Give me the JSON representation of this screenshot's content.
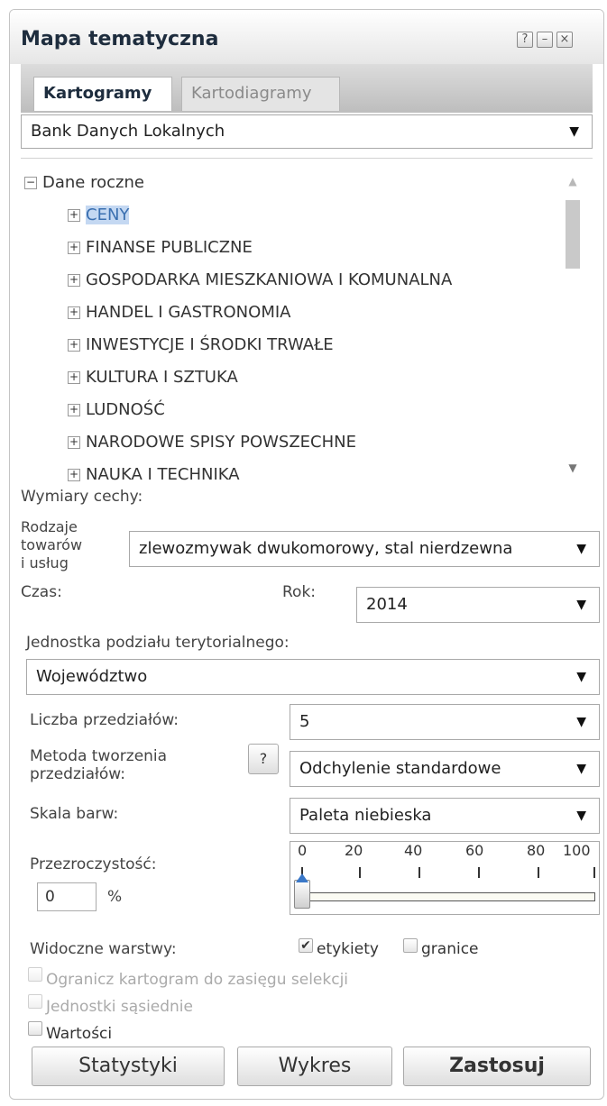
{
  "window": {
    "title": "Mapa tematyczna",
    "help_icon": "?",
    "minimize_icon": "–",
    "close_icon": "×"
  },
  "tabs": [
    {
      "label": "Kartogramy",
      "active": true
    },
    {
      "label": "Kartodiagramy",
      "active": false
    }
  ],
  "source_select": {
    "value": "Bank Danych Lokalnych"
  },
  "tree": {
    "root": {
      "toggle": "−",
      "label": "Dane roczne"
    },
    "items": [
      {
        "toggle": "+",
        "label": "CENY",
        "selected": true
      },
      {
        "toggle": "+",
        "label": "FINANSE PUBLICZNE"
      },
      {
        "toggle": "+",
        "label": "GOSPODARKA MIESZKANIOWA I KOMUNALNA"
      },
      {
        "toggle": "+",
        "label": "HANDEL I GASTRONOMIA"
      },
      {
        "toggle": "+",
        "label": "INWESTYCJE I ŚRODKI TRWAŁE"
      },
      {
        "toggle": "+",
        "label": "KULTURA I SZTUKA"
      },
      {
        "toggle": "+",
        "label": "LUDNOŚĆ"
      },
      {
        "toggle": "+",
        "label": "NARODOWE SPISY POWSZECHNE"
      },
      {
        "toggle": "+",
        "label": "NAUKA I TECHNIKA"
      }
    ]
  },
  "dimensions": {
    "heading": "Wymiary cechy:",
    "goods_label_line1": "Rodzaje",
    "goods_label_line2": "towarów",
    "goods_label_line3": "i usług",
    "goods_value": "zlewozmywak dwukomorowy, stal nierdzewna",
    "time_label": "Czas:",
    "year_label": "Rok:",
    "year_value": "2014"
  },
  "territorial": {
    "label": "Jednostka podziału terytorialnego:",
    "value": "Województwo"
  },
  "intervals": {
    "label": "Liczba przedziałów:",
    "value": "5"
  },
  "method": {
    "label_line1": "Metoda tworzenia",
    "label_line2": "przedziałów:",
    "help": "?",
    "value": "Odchylenie standardowe"
  },
  "color_scale": {
    "label": "Skala barw:",
    "value": "Paleta niebieska"
  },
  "opacity": {
    "label": "Przezroczystość:",
    "value": "0",
    "unit": "%",
    "slider_value": 0,
    "ticks": [
      "0",
      "20",
      "40",
      "60",
      "80",
      "100"
    ]
  },
  "layers": {
    "label": "Widoczne warstwy:",
    "labels_option": "etykiety",
    "labels_checked": true,
    "borders_option": "granice",
    "borders_checked": false
  },
  "options": {
    "limit_selection": "Ogranicz kartogram do zasięgu selekcji",
    "neighbors": "Jednostki sąsiednie",
    "values": "Wartości"
  },
  "buttons": {
    "stats": "Statystyki",
    "chart": "Wykres",
    "apply": "Zastosuj"
  }
}
